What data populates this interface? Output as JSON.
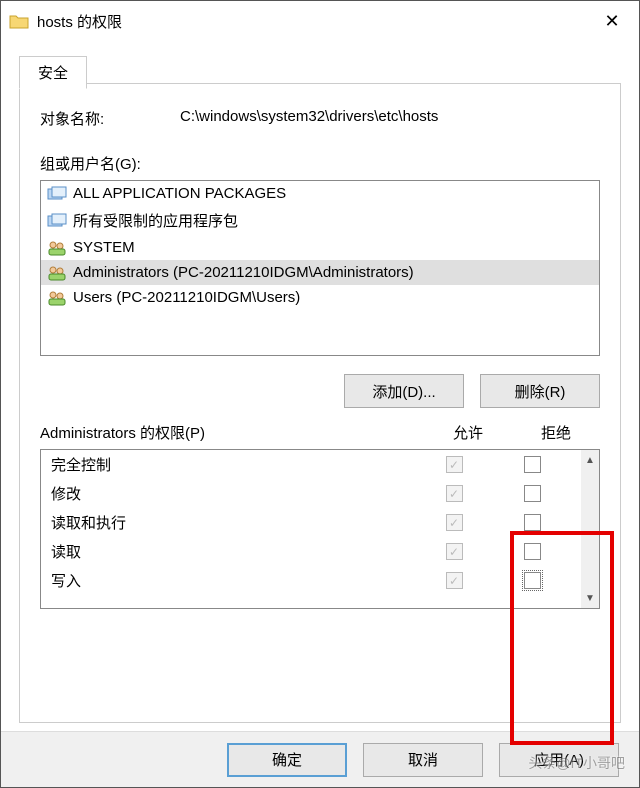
{
  "window": {
    "title": "hosts 的权限"
  },
  "tab": {
    "label": "安全"
  },
  "object": {
    "label": "对象名称:",
    "value": "C:\\windows\\system32\\drivers\\etc\\hosts"
  },
  "groups": {
    "label": "组或用户名(G):",
    "items": [
      {
        "icon": "package",
        "name": "ALL APPLICATION PACKAGES"
      },
      {
        "icon": "package",
        "name": "所有受限制的应用程序包"
      },
      {
        "icon": "users",
        "name": "SYSTEM"
      },
      {
        "icon": "users",
        "name": "Administrators (PC-20211210IDGM\\Administrators)"
      },
      {
        "icon": "users",
        "name": "Users (PC-20211210IDGM\\Users)"
      }
    ],
    "selected_index": 3
  },
  "buttons": {
    "add": "添加(D)...",
    "remove": "删除(R)",
    "ok": "确定",
    "cancel": "取消",
    "apply": "应用(A)"
  },
  "perm_header": {
    "for_label": "Administrators 的权限(P)",
    "allow": "允许",
    "deny": "拒绝"
  },
  "permissions": [
    {
      "name": "完全控制",
      "allow": true,
      "deny": false
    },
    {
      "name": "修改",
      "allow": true,
      "deny": false
    },
    {
      "name": "读取和执行",
      "allow": true,
      "deny": false
    },
    {
      "name": "读取",
      "allow": true,
      "deny": false
    },
    {
      "name": "写入",
      "allow": true,
      "deny": false
    }
  ],
  "watermark": "头条@IT小哥吧"
}
